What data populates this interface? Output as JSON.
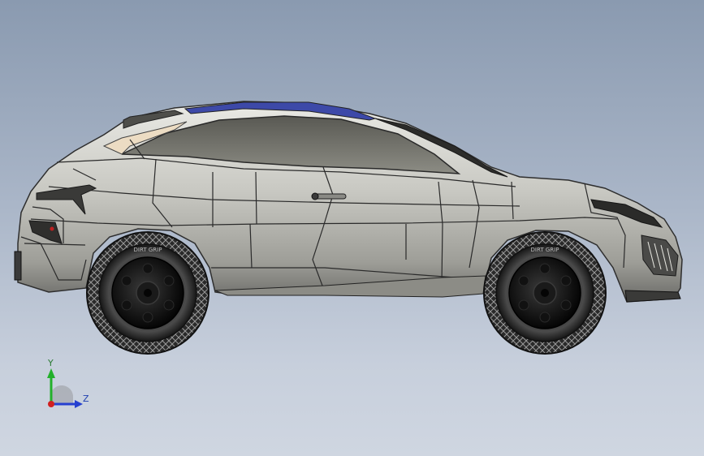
{
  "viewport": {
    "background_top": "#8a9ab0",
    "background_bottom": "#cfd6e1"
  },
  "model": {
    "body_color": "#c9c9c4",
    "body_dark": "#7f7f7a",
    "glass_color": "#6f6f68",
    "roof_stripe_color": "#3d49a8",
    "tire_color": "#1c1c1c",
    "rim_color": "#0e0e0e",
    "tire_text": "DIRT GRIP"
  },
  "triad": {
    "y_label": "Y",
    "z_label": "Z",
    "y_color": "#22b02a",
    "z_color": "#2540d0",
    "x_color": "#d02020"
  }
}
